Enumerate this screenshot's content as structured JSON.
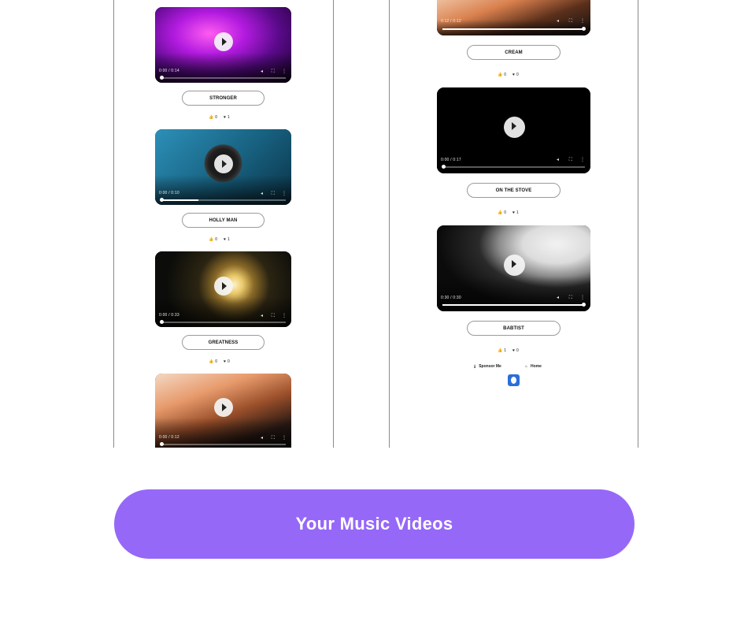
{
  "left_column": {
    "videos": [
      {
        "title": "STRONGER",
        "time": "0:00 / 0:14",
        "likes": "0",
        "hearts": "1",
        "progress": 0.0
      },
      {
        "title": "HOLLY MAN",
        "time": "0:00 / 0:10",
        "likes": "0",
        "hearts": "1",
        "progress": 0.3
      },
      {
        "title": "GREATNESS",
        "time": "0:00 / 0:33",
        "likes": "0",
        "hearts": "0",
        "progress": 0.0
      },
      {
        "time": "0:00 / 0:12",
        "progress": 0.0
      }
    ]
  },
  "right_column": {
    "videos": [
      {
        "title": "CREAM",
        "time": "0:12 / 0:12",
        "likes": "0",
        "hearts": "0",
        "progress": 1.0
      },
      {
        "title": "ON THE STOVE",
        "time": "0:00 / 0:17",
        "likes": "0",
        "hearts": "1",
        "progress": 0.0
      },
      {
        "title": "BABTIST",
        "time": "0:30 / 0:30",
        "likes": "1",
        "hearts": "0",
        "progress": 1.0
      }
    ]
  },
  "footer": {
    "sponsor_label": "Sponsor Me",
    "home_label": "Home"
  },
  "cta": {
    "label": "Your Music Videos"
  },
  "colors": {
    "cta": "#9668f8",
    "logo": "#2a6fd8"
  },
  "icons": {
    "play": "play-icon",
    "like": "thumbs-up-icon",
    "heart": "heart-icon",
    "volume": "volume-icon",
    "fullscreen": "fullscreen-icon",
    "menu": "more-vertical-icon",
    "sponsor": "sponsor-icon",
    "home": "home-icon"
  }
}
